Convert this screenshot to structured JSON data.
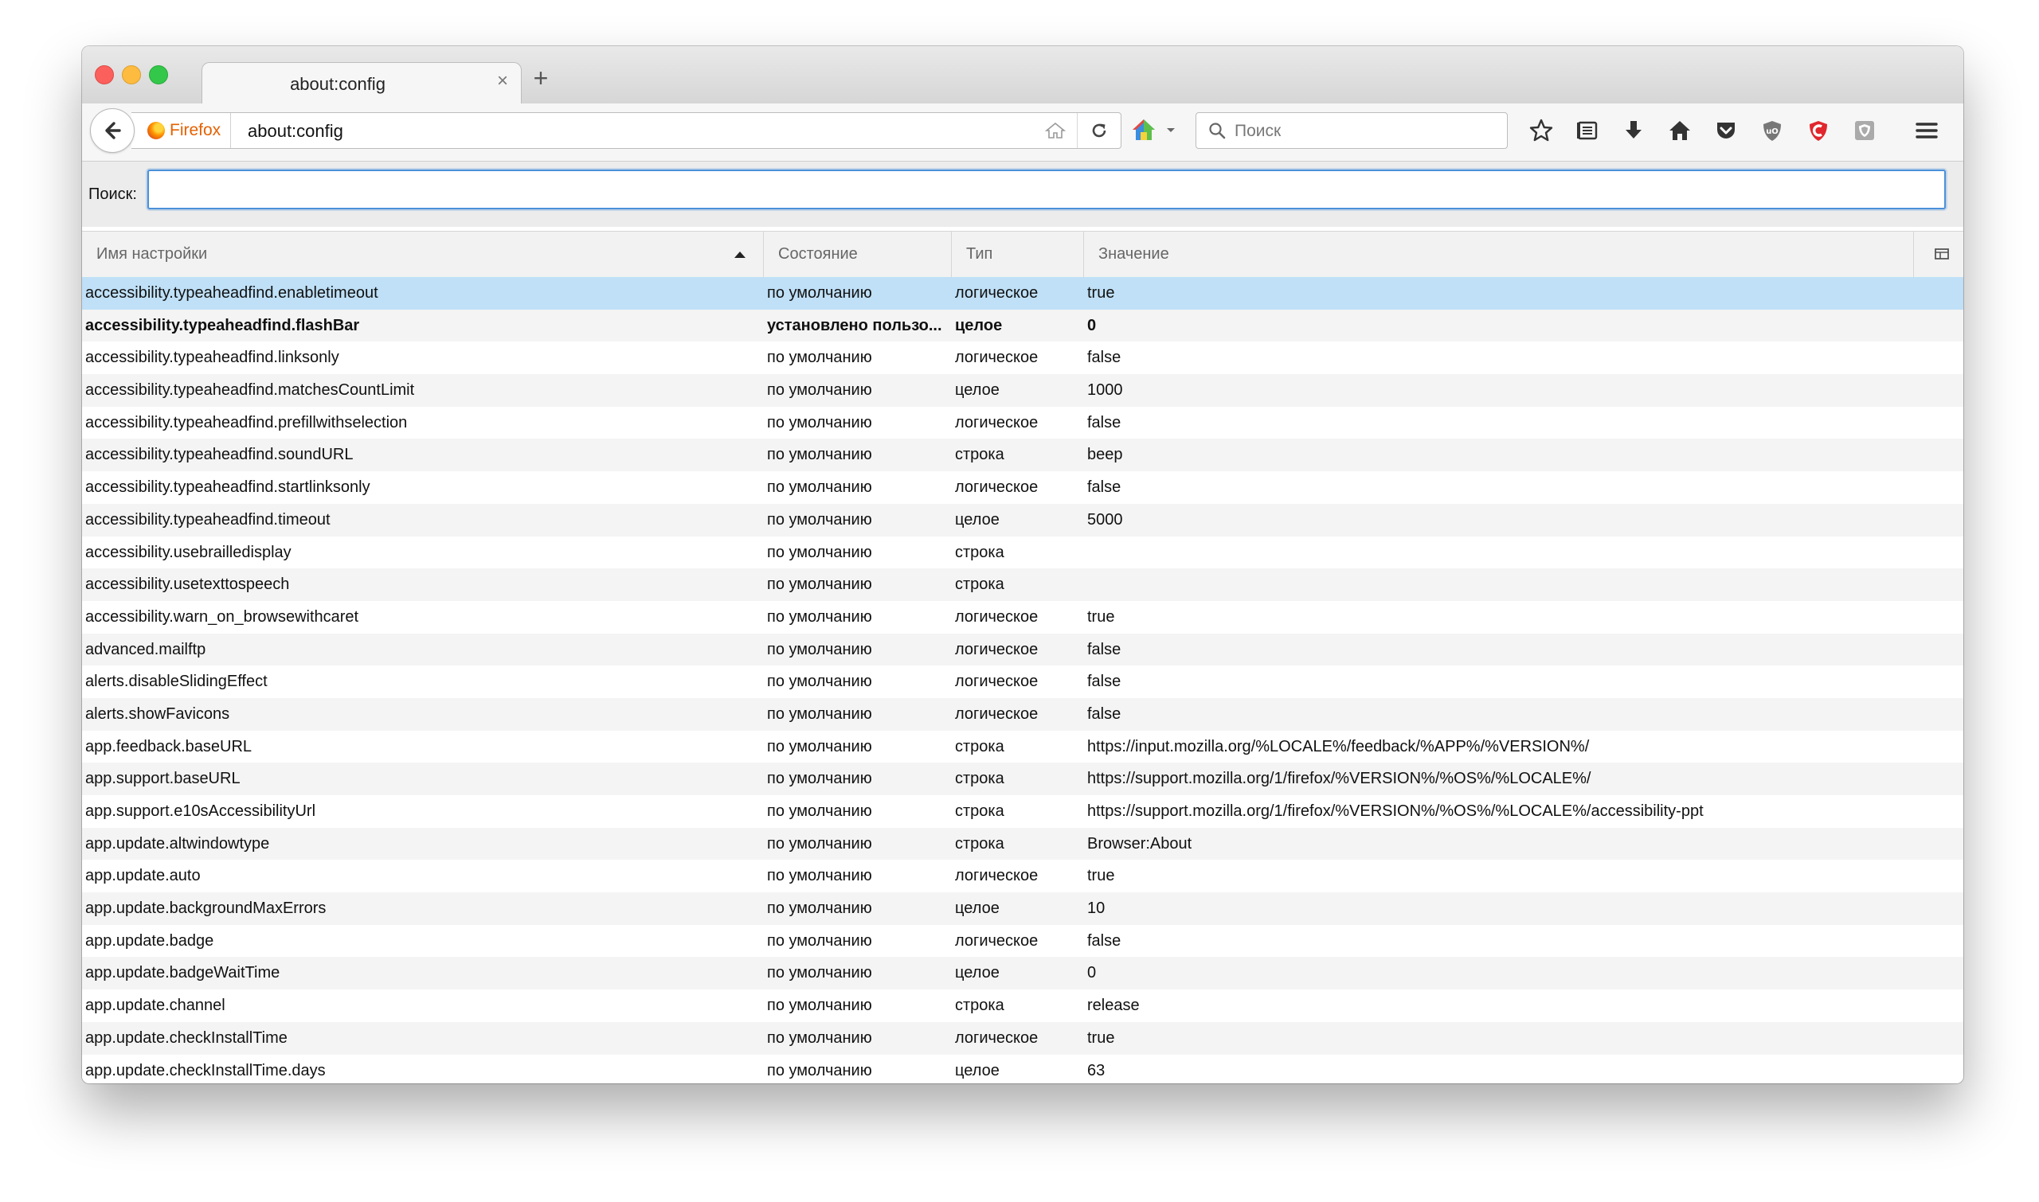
{
  "tab": {
    "title": "about:config",
    "close": "×",
    "new_tab": "+"
  },
  "urlbar": {
    "identity_label": "Firefox",
    "url": "about:config"
  },
  "searchbar": {
    "placeholder": "Поиск"
  },
  "filter": {
    "label": "Поиск:",
    "value": ""
  },
  "table": {
    "columns": [
      "Имя настройки",
      "Состояние",
      "Тип",
      "Значение"
    ],
    "rows": [
      {
        "name": "accessibility.typeaheadfind.enabletimeout",
        "state": "по умолчанию",
        "type": "логическое",
        "value": "true",
        "selected": true
      },
      {
        "name": "accessibility.typeaheadfind.flashBar",
        "state": "установлено пользо...",
        "type": "целое",
        "value": "0",
        "bold": true
      },
      {
        "name": "accessibility.typeaheadfind.linksonly",
        "state": "по умолчанию",
        "type": "логическое",
        "value": "false"
      },
      {
        "name": "accessibility.typeaheadfind.matchesCountLimit",
        "state": "по умолчанию",
        "type": "целое",
        "value": "1000"
      },
      {
        "name": "accessibility.typeaheadfind.prefillwithselection",
        "state": "по умолчанию",
        "type": "логическое",
        "value": "false"
      },
      {
        "name": "accessibility.typeaheadfind.soundURL",
        "state": "по умолчанию",
        "type": "строка",
        "value": "beep"
      },
      {
        "name": "accessibility.typeaheadfind.startlinksonly",
        "state": "по умолчанию",
        "type": "логическое",
        "value": "false"
      },
      {
        "name": "accessibility.typeaheadfind.timeout",
        "state": "по умолчанию",
        "type": "целое",
        "value": "5000"
      },
      {
        "name": "accessibility.usebrailledisplay",
        "state": "по умолчанию",
        "type": "строка",
        "value": ""
      },
      {
        "name": "accessibility.usetexttospeech",
        "state": "по умолчанию",
        "type": "строка",
        "value": ""
      },
      {
        "name": "accessibility.warn_on_browsewithcaret",
        "state": "по умолчанию",
        "type": "логическое",
        "value": "true"
      },
      {
        "name": "advanced.mailftp",
        "state": "по умолчанию",
        "type": "логическое",
        "value": "false"
      },
      {
        "name": "alerts.disableSlidingEffect",
        "state": "по умолчанию",
        "type": "логическое",
        "value": "false"
      },
      {
        "name": "alerts.showFavicons",
        "state": "по умолчанию",
        "type": "логическое",
        "value": "false"
      },
      {
        "name": "app.feedback.baseURL",
        "state": "по умолчанию",
        "type": "строка",
        "value": "https://input.mozilla.org/%LOCALE%/feedback/%APP%/%VERSION%/"
      },
      {
        "name": "app.support.baseURL",
        "state": "по умолчанию",
        "type": "строка",
        "value": "https://support.mozilla.org/1/firefox/%VERSION%/%OS%/%LOCALE%/"
      },
      {
        "name": "app.support.e10sAccessibilityUrl",
        "state": "по умолчанию",
        "type": "строка",
        "value": "https://support.mozilla.org/1/firefox/%VERSION%/%OS%/%LOCALE%/accessibility-ppt"
      },
      {
        "name": "app.update.altwindowtype",
        "state": "по умолчанию",
        "type": "строка",
        "value": "Browser:About"
      },
      {
        "name": "app.update.auto",
        "state": "по умолчанию",
        "type": "логическое",
        "value": "true"
      },
      {
        "name": "app.update.backgroundMaxErrors",
        "state": "по умолчанию",
        "type": "целое",
        "value": "10"
      },
      {
        "name": "app.update.badge",
        "state": "по умолчанию",
        "type": "логическое",
        "value": "false"
      },
      {
        "name": "app.update.badgeWaitTime",
        "state": "по умолчанию",
        "type": "целое",
        "value": "0"
      },
      {
        "name": "app.update.channel",
        "state": "по умолчанию",
        "type": "строка",
        "value": "release"
      },
      {
        "name": "app.update.checkInstallTime",
        "state": "по умолчанию",
        "type": "логическое",
        "value": "true"
      },
      {
        "name": "app.update.checkInstallTime.days",
        "state": "по умолчанию",
        "type": "целое",
        "value": "63"
      }
    ]
  },
  "colors": {
    "selection": "#bfe0f7",
    "focus": "#4a90d9",
    "firefox_brand": "#e66000",
    "pocket": "#ee4056"
  },
  "icons": [
    "back-icon",
    "firefox-icon",
    "home-icon",
    "reload-icon",
    "search-icon",
    "bookmark-star-icon",
    "reading-list-icon",
    "download-icon",
    "pocket-icon",
    "ublock-icon",
    "adblock-icon",
    "shield-icon",
    "menu-icon",
    "column-picker-icon"
  ]
}
